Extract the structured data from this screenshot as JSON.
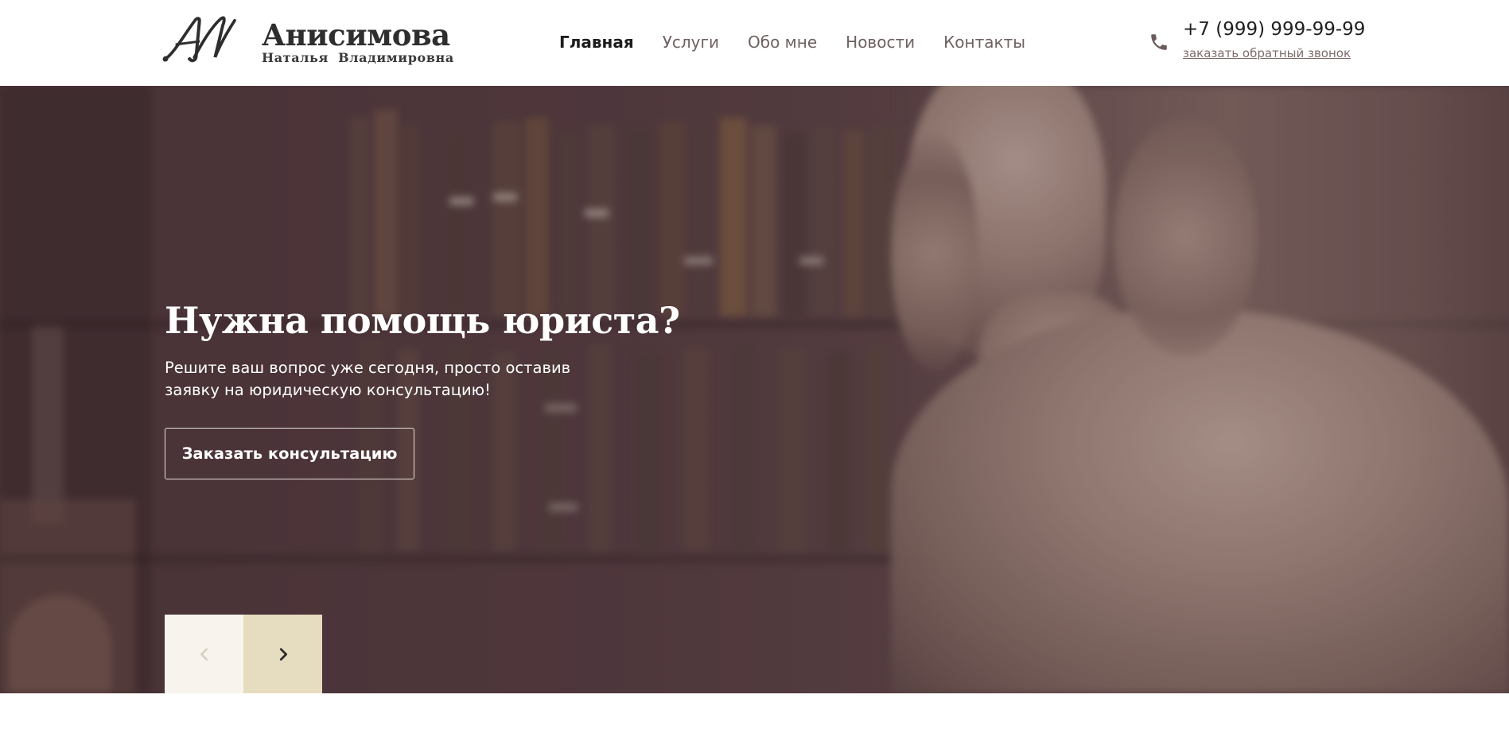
{
  "header": {
    "logo": {
      "monogram": "АН",
      "surname": "Анисимова",
      "full_name": "Наталья Владимировна"
    },
    "nav": [
      {
        "label": "Главная",
        "active": true
      },
      {
        "label": "Услуги",
        "active": false
      },
      {
        "label": "Обо мне",
        "active": false
      },
      {
        "label": "Новости",
        "active": false
      },
      {
        "label": "Контакты",
        "active": false
      }
    ],
    "contact": {
      "phone": "+7 (999) 999-99-99",
      "callback_link": "заказать обратный звонок",
      "icon": "phone-icon"
    }
  },
  "hero": {
    "title": "Нужна помощь юриста?",
    "subtitle": "Решите ваш вопрос уже сегодня, просто оставив заявку на юридическую консультацию!",
    "cta_label": "Заказать консультацию",
    "slider": {
      "prev_icon": "chevron-left-icon",
      "next_icon": "chevron-right-icon"
    }
  },
  "colors": {
    "text_dark": "#1d1d1d",
    "nav_text": "#6f6161",
    "hero_bg": "#533b40",
    "slider_prev_bg": "#f8f4ed",
    "slider_next_bg": "#e6dcbf"
  }
}
